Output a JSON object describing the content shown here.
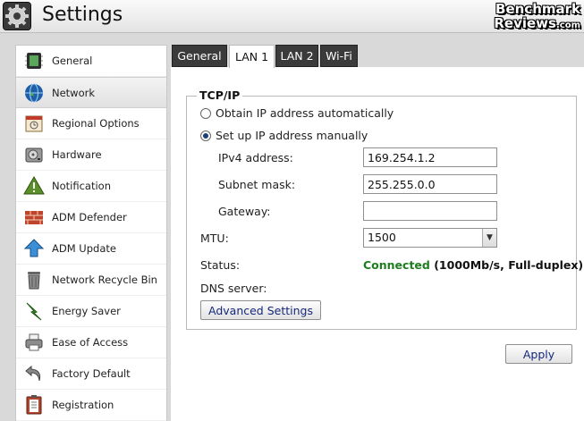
{
  "window": {
    "title": "Settings",
    "brand_line1": "Benchmark",
    "brand_line2": "Reviews",
    "brand_suffix": ".com"
  },
  "sidebar": {
    "items": [
      {
        "label": "General",
        "icon": "chip-icon"
      },
      {
        "label": "Network",
        "icon": "globe-icon"
      },
      {
        "label": "Regional Options",
        "icon": "calendar-icon"
      },
      {
        "label": "Hardware",
        "icon": "hard-drive-icon"
      },
      {
        "label": "Notification",
        "icon": "warning-icon"
      },
      {
        "label": "ADM Defender",
        "icon": "firewall-icon"
      },
      {
        "label": "ADM Update",
        "icon": "upload-arrow-icon"
      },
      {
        "label": "Network Recycle Bin",
        "icon": "trash-icon"
      },
      {
        "label": "Energy Saver",
        "icon": "lightning-icon"
      },
      {
        "label": "Ease of Access",
        "icon": "printer-icon"
      },
      {
        "label": "Factory Default",
        "icon": "undo-icon"
      },
      {
        "label": "Registration",
        "icon": "clipboard-icon"
      }
    ],
    "active_index": 1
  },
  "tabs": [
    {
      "label": "General"
    },
    {
      "label": "LAN 1"
    },
    {
      "label": "LAN 2"
    },
    {
      "label": "Wi-Fi"
    }
  ],
  "active_tab": "LAN 1",
  "tcpip": {
    "title": "TCP/IP",
    "option_auto": "Obtain IP address automatically",
    "option_manual": "Set up IP address manually",
    "selected": "manual",
    "ipv4_label": "IPv4 address:",
    "ipv4_value": "169.254.1.2",
    "subnet_label": "Subnet mask:",
    "subnet_value": "255.255.0.0",
    "gateway_label": "Gateway:",
    "gateway_value": "",
    "mtu_label": "MTU:",
    "mtu_value": "1500",
    "status_label": "Status:",
    "status_value": "Connected",
    "status_detail": " (1000Mb/s, Full-duplex)",
    "dns_label": "DNS server:",
    "advanced_button": "Advanced Settings"
  },
  "apply_button": "Apply",
  "colors": {
    "status_ok": "#1e7d1e",
    "tab_dark": "#3b3b3b",
    "button_text": "#15287a"
  }
}
